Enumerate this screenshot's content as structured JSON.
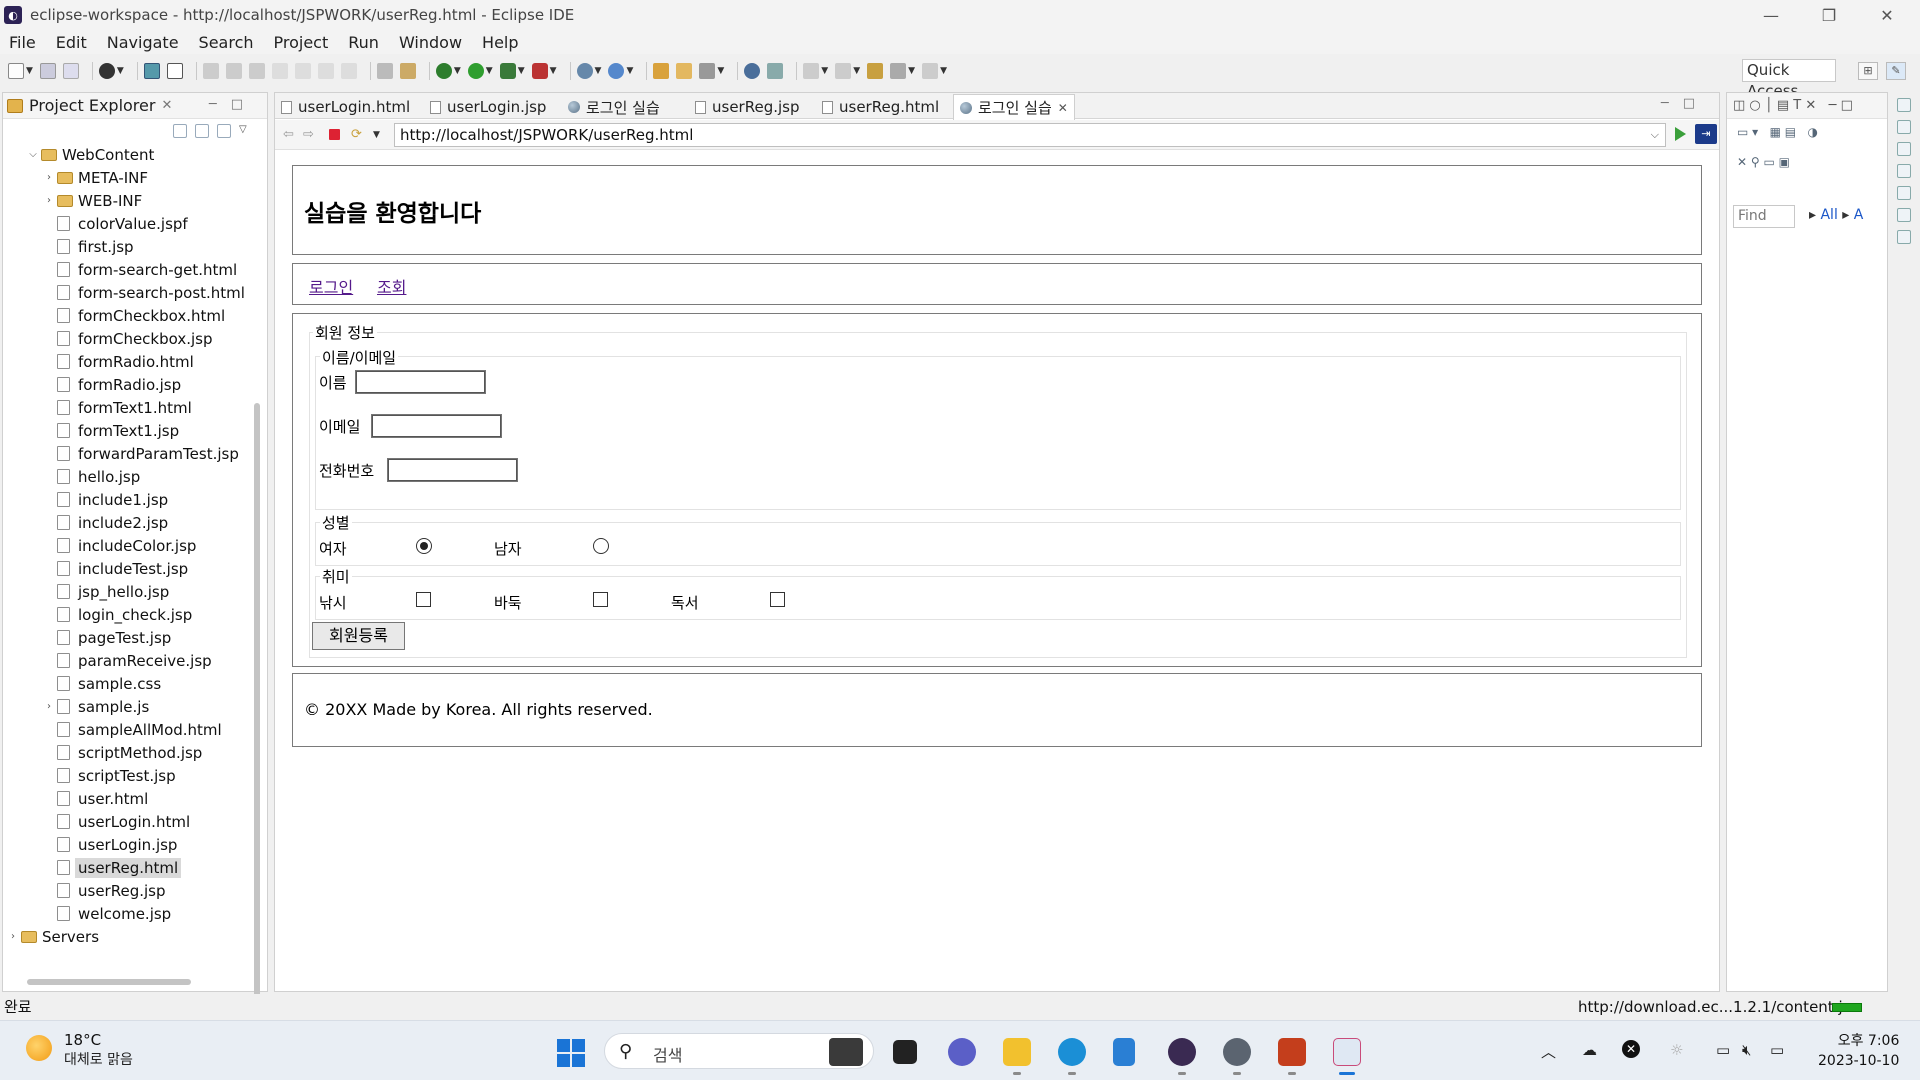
{
  "window": {
    "title": "eclipse-workspace - http://localhost/JSPWORK/userReg.html - Eclipse IDE",
    "controls": [
      "—",
      "❐",
      "✕"
    ]
  },
  "menu": [
    "File",
    "Edit",
    "Navigate",
    "Search",
    "Project",
    "Run",
    "Window",
    "Help"
  ],
  "toolbar": {
    "quick_access": "Quick Access"
  },
  "explorer": {
    "title": "Project Explorer",
    "nodes": [
      {
        "label": "WebContent",
        "type": "folder",
        "level": 1,
        "twisty": "expanded"
      },
      {
        "label": "META-INF",
        "type": "folder",
        "level": 2,
        "twisty": "collapsed"
      },
      {
        "label": "WEB-INF",
        "type": "folder",
        "level": 2,
        "twisty": "collapsed"
      },
      {
        "label": "colorValue.jspf",
        "type": "file",
        "level": 2
      },
      {
        "label": "first.jsp",
        "type": "file",
        "level": 2
      },
      {
        "label": "form-search-get.html",
        "type": "file",
        "level": 2
      },
      {
        "label": "form-search-post.html",
        "type": "file",
        "level": 2
      },
      {
        "label": "formCheckbox.html",
        "type": "file",
        "level": 2
      },
      {
        "label": "formCheckbox.jsp",
        "type": "file",
        "level": 2
      },
      {
        "label": "formRadio.html",
        "type": "file",
        "level": 2
      },
      {
        "label": "formRadio.jsp",
        "type": "file",
        "level": 2
      },
      {
        "label": "formText1.html",
        "type": "file",
        "level": 2
      },
      {
        "label": "formText1.jsp",
        "type": "file",
        "level": 2
      },
      {
        "label": "forwardParamTest.jsp",
        "type": "file",
        "level": 2
      },
      {
        "label": "hello.jsp",
        "type": "file",
        "level": 2
      },
      {
        "label": "include1.jsp",
        "type": "file",
        "level": 2
      },
      {
        "label": "include2.jsp",
        "type": "file",
        "level": 2
      },
      {
        "label": "includeColor.jsp",
        "type": "file",
        "level": 2
      },
      {
        "label": "includeTest.jsp",
        "type": "file",
        "level": 2
      },
      {
        "label": "jsp_hello.jsp",
        "type": "file",
        "level": 2
      },
      {
        "label": "login_check.jsp",
        "type": "file",
        "level": 2
      },
      {
        "label": "pageTest.jsp",
        "type": "file",
        "level": 2
      },
      {
        "label": "paramReceive.jsp",
        "type": "file",
        "level": 2
      },
      {
        "label": "sample.css",
        "type": "file",
        "level": 2
      },
      {
        "label": "sample.js",
        "type": "file",
        "level": 2,
        "twisty": "collapsed"
      },
      {
        "label": "sampleAllMod.html",
        "type": "file",
        "level": 2
      },
      {
        "label": "scriptMethod.jsp",
        "type": "file",
        "level": 2
      },
      {
        "label": "scriptTest.jsp",
        "type": "file",
        "level": 2
      },
      {
        "label": "user.html",
        "type": "file",
        "level": 2
      },
      {
        "label": "userLogin.html",
        "type": "file",
        "level": 2
      },
      {
        "label": "userLogin.jsp",
        "type": "file",
        "level": 2
      },
      {
        "label": "userReg.html",
        "type": "file",
        "level": 2,
        "selected": true
      },
      {
        "label": "userReg.jsp",
        "type": "file",
        "level": 2
      },
      {
        "label": "welcome.jsp",
        "type": "file",
        "level": 2
      },
      {
        "label": "Servers",
        "type": "folder",
        "level": 0,
        "twisty": "collapsed"
      }
    ]
  },
  "editor": {
    "tabs": [
      {
        "label": "userLogin.html",
        "icon": "file"
      },
      {
        "label": "userLogin.jsp",
        "icon": "file"
      },
      {
        "label": "로그인 실습",
        "icon": "globe"
      },
      {
        "label": "userReg.jsp",
        "icon": "file"
      },
      {
        "label": "userReg.html",
        "icon": "file"
      },
      {
        "label": "로그인 실습",
        "icon": "globe",
        "active": true
      }
    ],
    "url": "http://localhost/JSPWORK/userReg.html"
  },
  "page": {
    "heading": "실습을 환영합니다",
    "nav": [
      "로그인",
      "조회"
    ],
    "form": {
      "legend": "회원 정보",
      "name_email_legend": "이름/이메일",
      "name_label": "이름",
      "email_label": "이메일",
      "phone_label": "전화번호",
      "name_value": "",
      "email_value": "",
      "phone_value": "",
      "gender_legend": "성별",
      "gender_female": "여자",
      "gender_male": "남자",
      "gender_selected": "여자",
      "hobby_legend": "취미",
      "hobby_fishing": "낚시",
      "hobby_baduk": "바둑",
      "hobby_reading": "독서",
      "submit_label": "회원등록"
    },
    "footer": "© 20XX Made by Korea. All rights reserved."
  },
  "right_panel": {
    "find_placeholder": "Find",
    "all_label": "All",
    "a_label": "A"
  },
  "status": {
    "left": "완료",
    "right": "http://download.ec...1.2.1/content.jar"
  },
  "taskbar": {
    "temp": "18°C",
    "weather": "대체로 맑음",
    "search_placeholder": "검색",
    "time": "오후 7:06",
    "date": "2023-10-10"
  }
}
